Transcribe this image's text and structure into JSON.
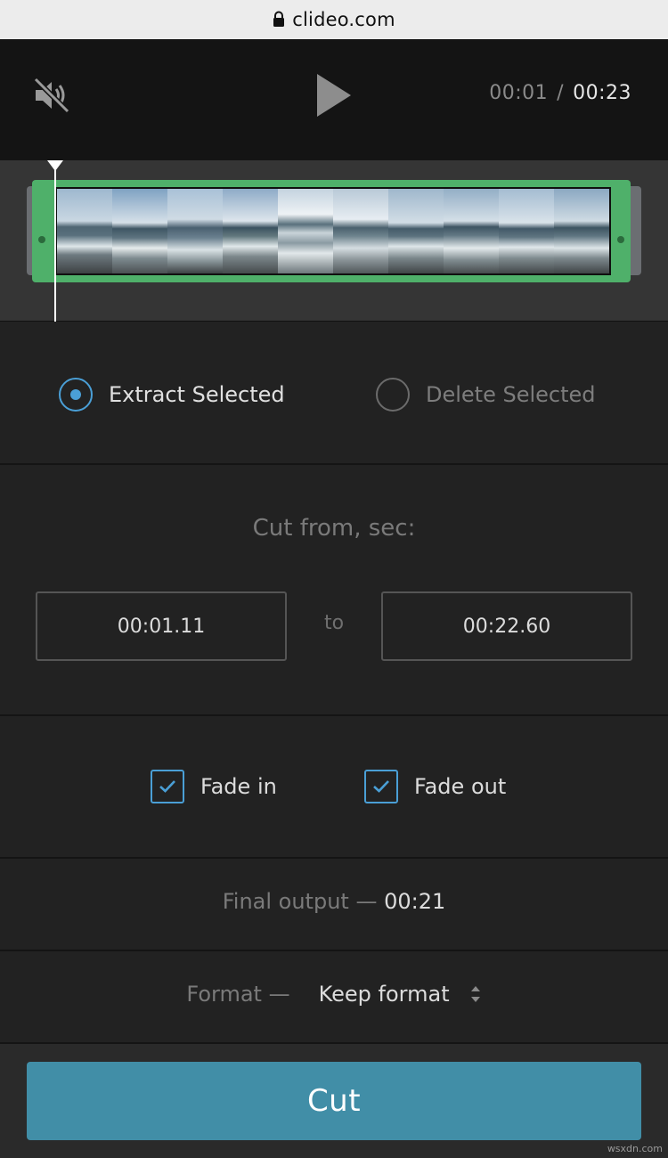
{
  "browser": {
    "url": "clideo.com"
  },
  "player": {
    "current_time": "00:01",
    "separator": "/",
    "total_time": "00:23"
  },
  "mode": {
    "extract_label": "Extract Selected",
    "delete_label": "Delete Selected",
    "selected": "extract"
  },
  "cut": {
    "title": "Cut from, sec:",
    "from_value": "00:01.11",
    "to_label": "to",
    "to_value": "00:22.60"
  },
  "fade": {
    "fade_in_label": "Fade in",
    "fade_in_checked": true,
    "fade_out_label": "Fade out",
    "fade_out_checked": true
  },
  "output": {
    "label": "Final output —",
    "value": "00:21"
  },
  "format": {
    "label": "Format —",
    "value": "Keep format"
  },
  "action": {
    "cut_label": "Cut"
  },
  "watermark": "wsxdn.com",
  "colors": {
    "accent": "#4a9fd6",
    "selection": "#4fb06a",
    "button": "#418ea7"
  }
}
